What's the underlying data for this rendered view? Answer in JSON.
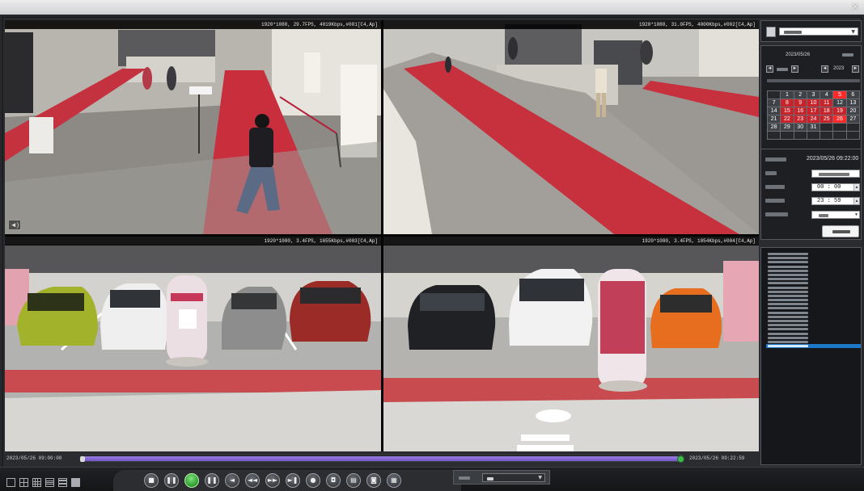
{
  "window": {
    "close_glyph": "×"
  },
  "cameras": [
    {
      "id": "cam1",
      "header": "1920*1080, 29.7FPS, 4019Kbps,#001[C4,Ap]",
      "scene": "lobby-red-carpet-walker"
    },
    {
      "id": "cam2",
      "header": "1920*1080, 31.0FPS, 4000Kbps,#002[C4,Ap]",
      "scene": "lobby-red-carpet-counter"
    },
    {
      "id": "cam3",
      "header": "1920*1080, 3.4FPS, 1655Kbps,#003[C4,Ap]",
      "scene": "parking-four-cars"
    },
    {
      "id": "cam4",
      "header": "1920*1080, 3.4FPS, 1054Kbps,#004[C4,Ap]",
      "scene": "parking-three-cars"
    }
  ],
  "sidebar": {
    "calendar": {
      "month_label": "2023/05/26",
      "year_value": "2023",
      "prev_glyph": "◄",
      "next_glyph": "►",
      "weeks": [
        [
          "",
          "1",
          "2",
          "3",
          "4",
          "5",
          "6"
        ],
        [
          "7",
          "8",
          "9",
          "10",
          "11",
          "12",
          "13"
        ],
        [
          "14",
          "15",
          "16",
          "17",
          "18",
          "19",
          "20"
        ],
        [
          "21",
          "22",
          "23",
          "24",
          "25",
          "26",
          "27"
        ],
        [
          "28",
          "29",
          "30",
          "31",
          "",
          "",
          ""
        ],
        [
          "",
          "",
          "",
          "",
          "",
          "",
          ""
        ]
      ],
      "marked_days": [
        "5",
        "8",
        "9",
        "10",
        "11",
        "15",
        "16",
        "17",
        "18",
        "19",
        "22",
        "23",
        "24",
        "25",
        "26"
      ],
      "bright_days": [
        "5",
        "26"
      ]
    },
    "search": {
      "date_value": "2023/05/26 09:22:00",
      "start_time": "00 : 00",
      "end_time": "23 : 59"
    },
    "results": [
      "2023/05/26 09:00:00",
      "2023/05/26 09:01:00",
      "2023/05/26 09:02:00",
      "2023/05/26 09:03:00",
      "2023/05/26 09:04:00",
      "2023/05/26 09:05:00",
      "2023/05/26 09:06:00",
      "2023/05/26 09:07:00",
      "2023/05/26 09:08:00",
      "2023/05/26 09:09:00",
      "2023/05/26 09:10:00",
      "2023/05/26 09:11:00",
      "2023/05/26 09:12:00",
      "2023/05/26 09:13:00",
      "2023/05/26 09:14:00",
      "2023/05/26 09:15:00",
      "2023/05/26 09:16:00",
      "2023/05/26 09:17:00",
      "2023/05/26 09:18:00",
      "2023/05/26 09:19:00",
      "2023/05/26 09:20:00",
      "2023/05/26 09:21:00",
      "2023/05/26 09:22:00"
    ],
    "selected_result_index": 22
  },
  "timeline": {
    "start": "2023/05/26 09:00:00",
    "end": "2023/05/26 09:22:59",
    "played_fraction": 1.0
  },
  "controls": {
    "layouts": [
      "layout-1x1",
      "layout-2x2",
      "layout-3x3",
      "layout-4x4",
      "layout-5x5",
      "layout-6x6"
    ],
    "playback_buttons": [
      {
        "name": "stop-button",
        "glyph": "■"
      },
      {
        "name": "pause-button",
        "glyph": "❚❚"
      },
      {
        "name": "play-button",
        "glyph": "",
        "active": true
      },
      {
        "name": "pause-alt-button",
        "glyph": "❚❚"
      },
      {
        "name": "reverse-button",
        "glyph": "◄"
      },
      {
        "name": "rewind-button",
        "glyph": "◄◄"
      },
      {
        "name": "fast-forward-button",
        "glyph": "►►"
      },
      {
        "name": "step-forward-button",
        "glyph": "►❚"
      },
      {
        "name": "record-button",
        "glyph": "●"
      },
      {
        "name": "snapshot-button",
        "glyph": "◘"
      },
      {
        "name": "export-button",
        "glyph": "▤"
      },
      {
        "name": "mute-button",
        "glyph": "◙"
      },
      {
        "name": "fullscreen-button",
        "glyph": "▦"
      }
    ]
  },
  "colors": {
    "accent_selection": "#1e78c8",
    "timeline_fill": "#7254c8",
    "calendar_marked": "#c8222a",
    "play_active": "#2c9a2c"
  }
}
